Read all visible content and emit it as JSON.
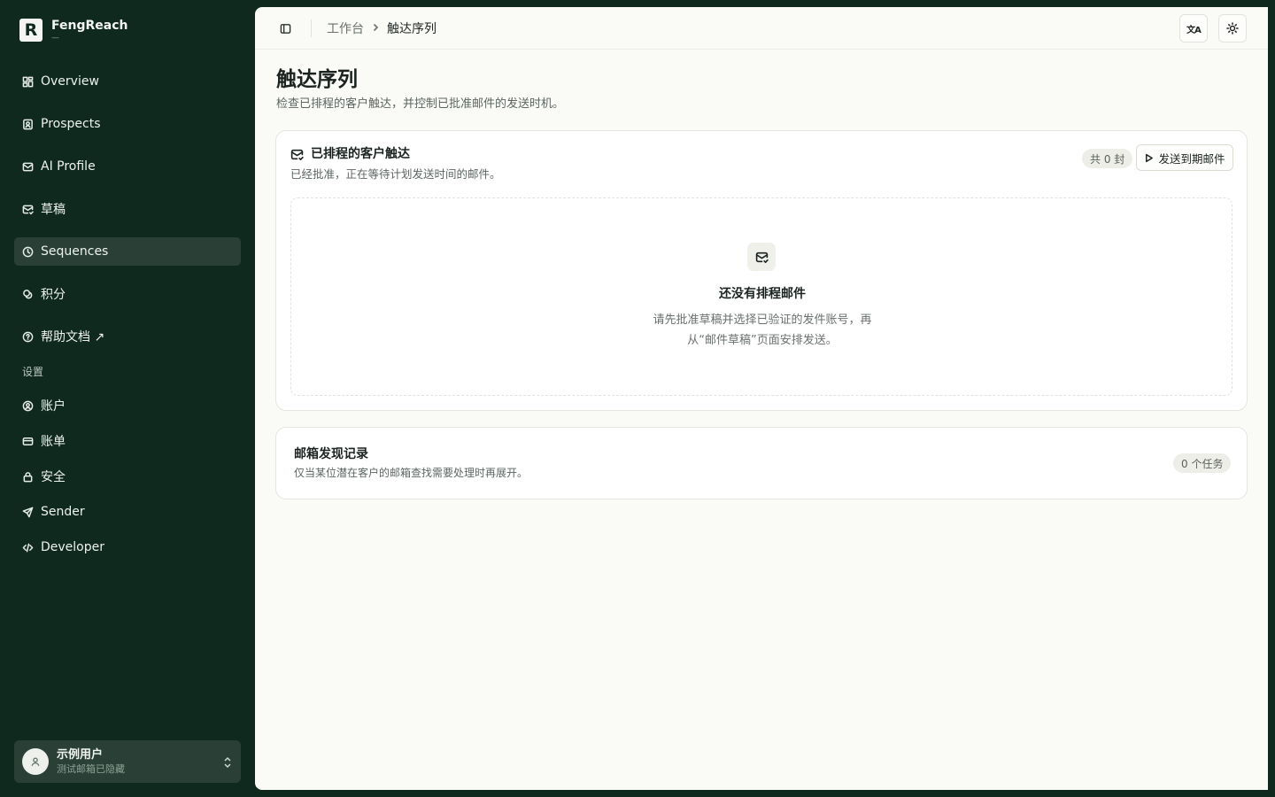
{
  "app": {
    "name": "FengReach",
    "subtitle": "—"
  },
  "sidebar": {
    "nav_items": [
      {
        "label": "Overview",
        "icon": "dashboard-icon"
      },
      {
        "label": "Prospects",
        "icon": "prospects-icon"
      },
      {
        "label": "AI Profile",
        "icon": "profile-icon"
      },
      {
        "label": "草稿",
        "icon": "mail-draft-icon"
      },
      {
        "label": "Sequences",
        "icon": "clock-icon",
        "active": true
      },
      {
        "label": "积分",
        "icon": "coins-icon"
      },
      {
        "label": "帮助文档 ↗",
        "icon": "help-circle-icon"
      }
    ],
    "settings_label": "设置",
    "settings_items": [
      {
        "label": "账户",
        "icon": "user-circle-icon"
      },
      {
        "label": "账单",
        "icon": "credit-card-icon"
      },
      {
        "label": "安全",
        "icon": "lock-icon"
      },
      {
        "label": "Sender",
        "icon": "send-icon"
      },
      {
        "label": "Developer",
        "icon": "code-icon"
      }
    ],
    "user": {
      "name": "示例用户",
      "email": "测试邮箱已隐藏"
    }
  },
  "header": {
    "breadcrumb_root": "工作台",
    "breadcrumb_current": "触达序列",
    "lang_glyph": "文A"
  },
  "page": {
    "title": "触达序列",
    "description": "检查已排程的客户触达，并控制已批准邮件的发送时机。"
  },
  "scheduled": {
    "title": "已排程的客户触达",
    "description": "已经批准，正在等待计划发送时间的邮件。",
    "count_badge": "共 0 封",
    "send_button": "发送到期邮件",
    "empty_title": "还没有排程邮件",
    "empty_description": "请先批准草稿并选择已验证的发件账号，再从“邮件草稿”页面安排发送。"
  },
  "discovery": {
    "title": "邮箱发现记录",
    "description": "仅当某位潜在客户的邮箱查找需要处理时再展开。",
    "task_badge": "0 个任务"
  },
  "colors": {
    "sidebar_bg": "#10291f",
    "active_item_bg": "#2a4037",
    "main_bg": "#fafaf7"
  }
}
